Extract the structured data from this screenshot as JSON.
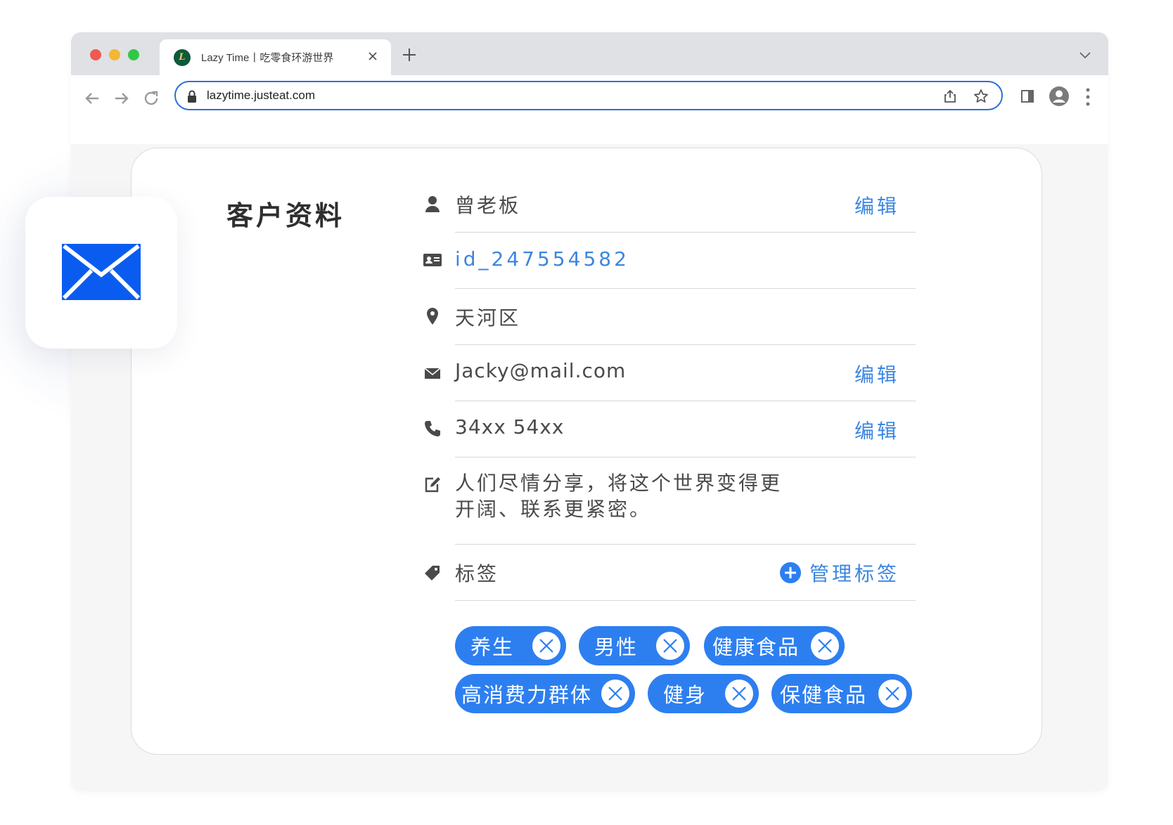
{
  "browser": {
    "tab_title": "Lazy Time丨吃零食环游世界",
    "favicon_letter": "L",
    "url": "lazytime.justeat.com"
  },
  "profile": {
    "title": "客户资料",
    "name": "曾老板",
    "id": "id_247554582",
    "district": "天河区",
    "email": "Jacky@mail.com",
    "phone": "34xx 54xx",
    "note_line1": "人们尽情分享，将这个世界变得更",
    "note_line2": "开阔、联系更紧密。",
    "edit_label": "编辑",
    "tags_label": "标签",
    "manage_tags_label": "管理标签"
  },
  "tags": [
    "养生",
    "男性",
    "健康食品",
    "高消费力群体",
    "健身",
    "保健食品"
  ],
  "colors": {
    "accent": "#2d7ff0",
    "link": "#3b86e0",
    "mail_icon": "#0a5cf0"
  }
}
